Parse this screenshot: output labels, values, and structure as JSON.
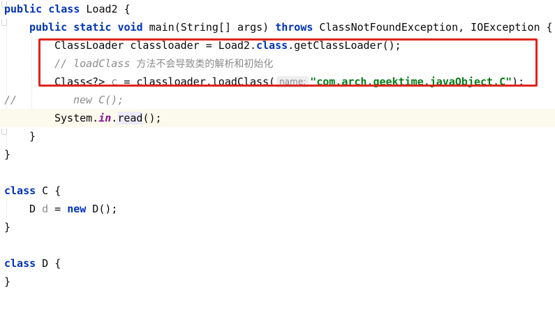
{
  "editor": {
    "lines": [
      {
        "id": "l1",
        "tokens": [
          "public",
          " ",
          "class",
          " Load2 {"
        ]
      },
      {
        "id": "l2",
        "tokens": [
          "public",
          " ",
          "static",
          " ",
          "void",
          " main(String[] args) ",
          "throws",
          " ClassNotFoundException, IOException {"
        ]
      },
      {
        "id": "l3",
        "tokens": [
          "ClassLoader classloader = Load2.",
          "class",
          ".getClassLoader();"
        ]
      },
      {
        "id": "l4",
        "tokens": [
          "// loadClass ",
          "方法不会导致类的解析和初始化"
        ]
      },
      {
        "id": "l5",
        "tokens": [
          "Class<?> ",
          "c",
          " = classloader.loadClass(",
          "name:",
          "\"com.arch.geektime.javaObject.C\"",
          ");"
        ]
      },
      {
        "id": "l6",
        "tokens": [
          "//",
          "new C();"
        ]
      },
      {
        "id": "l7",
        "tokens": [
          "System.",
          "in",
          ".",
          "read",
          "();"
        ]
      },
      {
        "id": "l8",
        "tokens": [
          "}"
        ]
      },
      {
        "id": "l9",
        "tokens": [
          "}"
        ]
      },
      {
        "id": "l10",
        "tokens": []
      },
      {
        "id": "l11",
        "tokens": [
          "class",
          " C {"
        ]
      },
      {
        "id": "l12",
        "tokens": [
          "D ",
          "d",
          " = ",
          "new",
          " D();"
        ]
      },
      {
        "id": "l13",
        "tokens": [
          "}"
        ]
      },
      {
        "id": "l14",
        "tokens": []
      },
      {
        "id": "l15",
        "tokens": [
          "class",
          " D {"
        ]
      },
      {
        "id": "l16",
        "tokens": [
          "}"
        ]
      }
    ]
  },
  "colors": {
    "keyword": "#0033b3",
    "string": "#067d17",
    "comment": "#8c8c8c",
    "static_field": "#871094",
    "highlight_box": "#e0241c",
    "current_line": "#fcfaed"
  }
}
